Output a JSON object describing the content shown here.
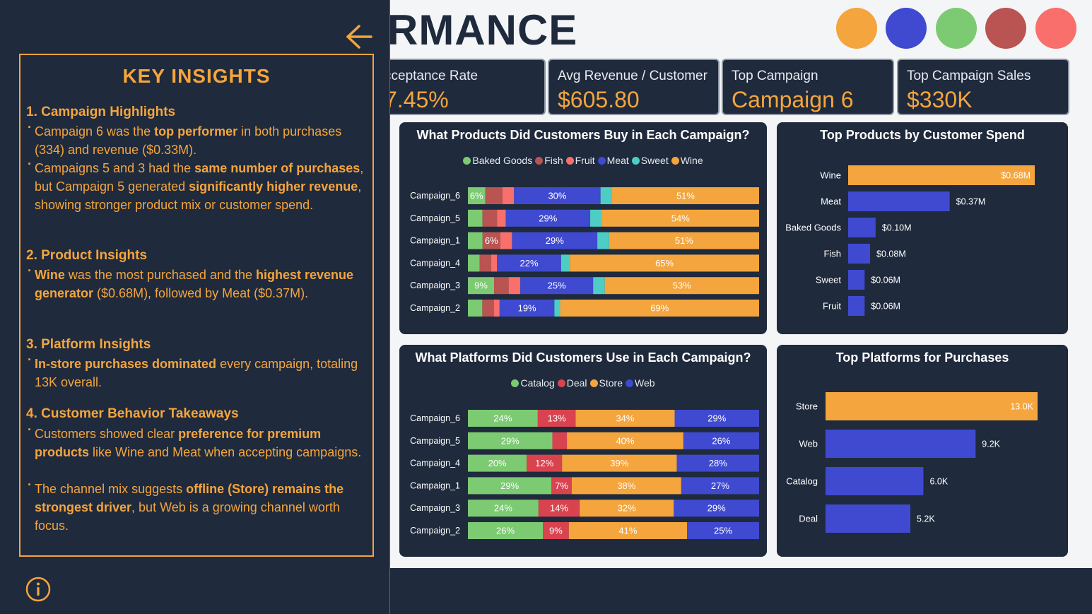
{
  "header": {
    "title_visible": "RMANCE"
  },
  "theme_circles": [
    {
      "name": "theme-circle-orange",
      "color": "#f4a53d"
    },
    {
      "name": "theme-circle-blue",
      "color": "#3f4ad1"
    },
    {
      "name": "theme-circle-green",
      "color": "#7cca72"
    },
    {
      "name": "theme-circle-darkred",
      "color": "#b95452"
    },
    {
      "name": "theme-circle-pink",
      "color": "#f86f6c"
    }
  ],
  "kpis": [
    {
      "label": "cceptance Rate",
      "value": "7.45%"
    },
    {
      "label": "Avg Revenue / Customer",
      "value": "$605.80"
    },
    {
      "label": "Top Campaign",
      "value": "Campaign 6"
    },
    {
      "label": "Top Campaign Sales",
      "value": "$330K"
    }
  ],
  "colors": {
    "baked_goods": "#7cca72",
    "fish": "#b95452",
    "fruit": "#f86f6c",
    "meat": "#3f4ad1",
    "sweet": "#4ecdc4",
    "wine": "#f4a53d",
    "catalog": "#7cca72",
    "deal": "#d9434f",
    "store": "#f4a53d",
    "web": "#3f4ad1"
  },
  "products_chart": {
    "title": "What Products Did Customers Buy in Each Campaign?",
    "legend": [
      "Baked Goods",
      "Fish",
      "Fruit",
      "Meat",
      "Sweet",
      "Wine"
    ]
  },
  "top_products_chart": {
    "title": "Top Products by Customer Spend"
  },
  "platforms_chart": {
    "title": "What Platforms Did Customers Use in Each Campaign?",
    "legend": [
      "Catalog",
      "Deal",
      "Store",
      "Web"
    ]
  },
  "top_platforms_chart": {
    "title": "Top Platforms for Purchases"
  },
  "chart_data": [
    {
      "type": "bar",
      "stacked": "100%",
      "orientation": "horizontal",
      "title": "What Products Did Customers Buy in Each Campaign?",
      "categories": [
        "Campaign_6",
        "Campaign_5",
        "Campaign_1",
        "Campaign_4",
        "Campaign_3",
        "Campaign_2"
      ],
      "series": [
        {
          "name": "Baked Goods",
          "values": [
            6,
            5,
            5,
            4,
            9,
            5
          ],
          "labels": [
            "6%",
            "",
            "",
            "",
            "9%",
            ""
          ]
        },
        {
          "name": "Fish",
          "values": [
            6,
            5,
            6,
            4,
            5,
            4
          ],
          "labels": [
            "",
            "",
            "6%",
            "",
            "",
            ""
          ]
        },
        {
          "name": "Fruit",
          "values": [
            4,
            3,
            4,
            2,
            4,
            2
          ],
          "labels": [
            "",
            "",
            "",
            "",
            "",
            ""
          ]
        },
        {
          "name": "Meat",
          "values": [
            30,
            29,
            29,
            22,
            25,
            19
          ],
          "labels": [
            "30%",
            "29%",
            "29%",
            "22%",
            "25%",
            "19%"
          ]
        },
        {
          "name": "Sweet",
          "values": [
            4,
            4,
            4,
            3,
            4,
            2
          ],
          "labels": [
            "",
            "",
            "",
            "",
            "",
            ""
          ]
        },
        {
          "name": "Wine",
          "values": [
            51,
            54,
            51,
            65,
            53,
            69
          ],
          "labels": [
            "51%",
            "54%",
            "51%",
            "65%",
            "53%",
            "69%"
          ]
        }
      ]
    },
    {
      "type": "bar",
      "orientation": "horizontal",
      "title": "Top Products by Customer Spend",
      "categories": [
        "Wine",
        "Meat",
        "Baked Goods",
        "Fish",
        "Sweet",
        "Fruit"
      ],
      "values": [
        0.68,
        0.37,
        0.1,
        0.08,
        0.06,
        0.06
      ],
      "value_labels": [
        "$0.68M",
        "$0.37M",
        "$0.10M",
        "$0.08M",
        "$0.06M",
        "$0.06M"
      ]
    },
    {
      "type": "bar",
      "stacked": "100%",
      "orientation": "horizontal",
      "title": "What Platforms Did Customers Use in Each Campaign?",
      "categories": [
        "Campaign_6",
        "Campaign_5",
        "Campaign_4",
        "Campaign_1",
        "Campaign_3",
        "Campaign_2"
      ],
      "series": [
        {
          "name": "Catalog",
          "values": [
            24,
            29,
            20,
            29,
            24,
            26
          ],
          "labels": [
            "24%",
            "29%",
            "20%",
            "29%",
            "24%",
            "26%"
          ]
        },
        {
          "name": "Deal",
          "values": [
            13,
            5,
            12,
            7,
            14,
            9
          ],
          "labels": [
            "13%",
            "",
            "12%",
            "7%",
            "14%",
            "9%"
          ]
        },
        {
          "name": "Store",
          "values": [
            34,
            40,
            39,
            38,
            32,
            41
          ],
          "labels": [
            "34%",
            "40%",
            "39%",
            "38%",
            "32%",
            "41%"
          ]
        },
        {
          "name": "Web",
          "values": [
            29,
            26,
            28,
            27,
            29,
            25
          ],
          "labels": [
            "29%",
            "26%",
            "28%",
            "27%",
            "29%",
            "25%"
          ]
        }
      ]
    },
    {
      "type": "bar",
      "orientation": "horizontal",
      "title": "Top Platforms for Purchases",
      "categories": [
        "Store",
        "Web",
        "Catalog",
        "Deal"
      ],
      "values": [
        13.0,
        9.2,
        6.0,
        5.2
      ],
      "value_labels": [
        "13.0K",
        "9.2K",
        "6.0K",
        "5.2K"
      ]
    }
  ],
  "insights": {
    "title": "KEY INSIGHTS",
    "sections": [
      {
        "heading": "1. Campaign Highlights",
        "bullets": [
          [
            {
              "t": "Campaign 6 was the "
            },
            {
              "t": "top performer",
              "b": true
            },
            {
              "t": " in both purchases (334) and revenue ($0.33M)."
            }
          ],
          [
            {
              "t": "Campaigns 5 and 3 had the "
            },
            {
              "t": "same number of purchases",
              "b": true
            },
            {
              "t": ", but Campaign 5 generated "
            },
            {
              "t": "significantly higher revenue",
              "b": true
            },
            {
              "t": ", showing stronger product mix or customer spend."
            }
          ]
        ]
      },
      {
        "heading": "2. Product Insights",
        "bullets": [
          [
            {
              "t": "Wine",
              "b": true
            },
            {
              "t": " was the most purchased and the "
            },
            {
              "t": "highest revenue generator",
              "b": true
            },
            {
              "t": " ($0.68M), followed by Meat ($0.37M)."
            }
          ]
        ]
      },
      {
        "heading": "3. Platform Insights",
        "bullets": [
          [
            {
              "t": "In-store purchases dominated",
              "b": true
            },
            {
              "t": " every campaign, totaling 13K overall."
            }
          ]
        ]
      },
      {
        "heading": "4. Customer Behavior Takeaways",
        "bullets": [
          [
            {
              "t": "Customers showed clear "
            },
            {
              "t": "preference for premium products",
              "b": true
            },
            {
              "t": " like Wine and Meat when accepting campaigns."
            }
          ],
          [
            {
              "t": "The channel mix suggests "
            },
            {
              "t": "offline (Store) remains the strongest driver",
              "b": true
            },
            {
              "t": ", but Web is a growing channel worth focus."
            }
          ]
        ]
      }
    ]
  },
  "icons": {
    "back": "arrow-left-icon",
    "info": "info-icon"
  }
}
